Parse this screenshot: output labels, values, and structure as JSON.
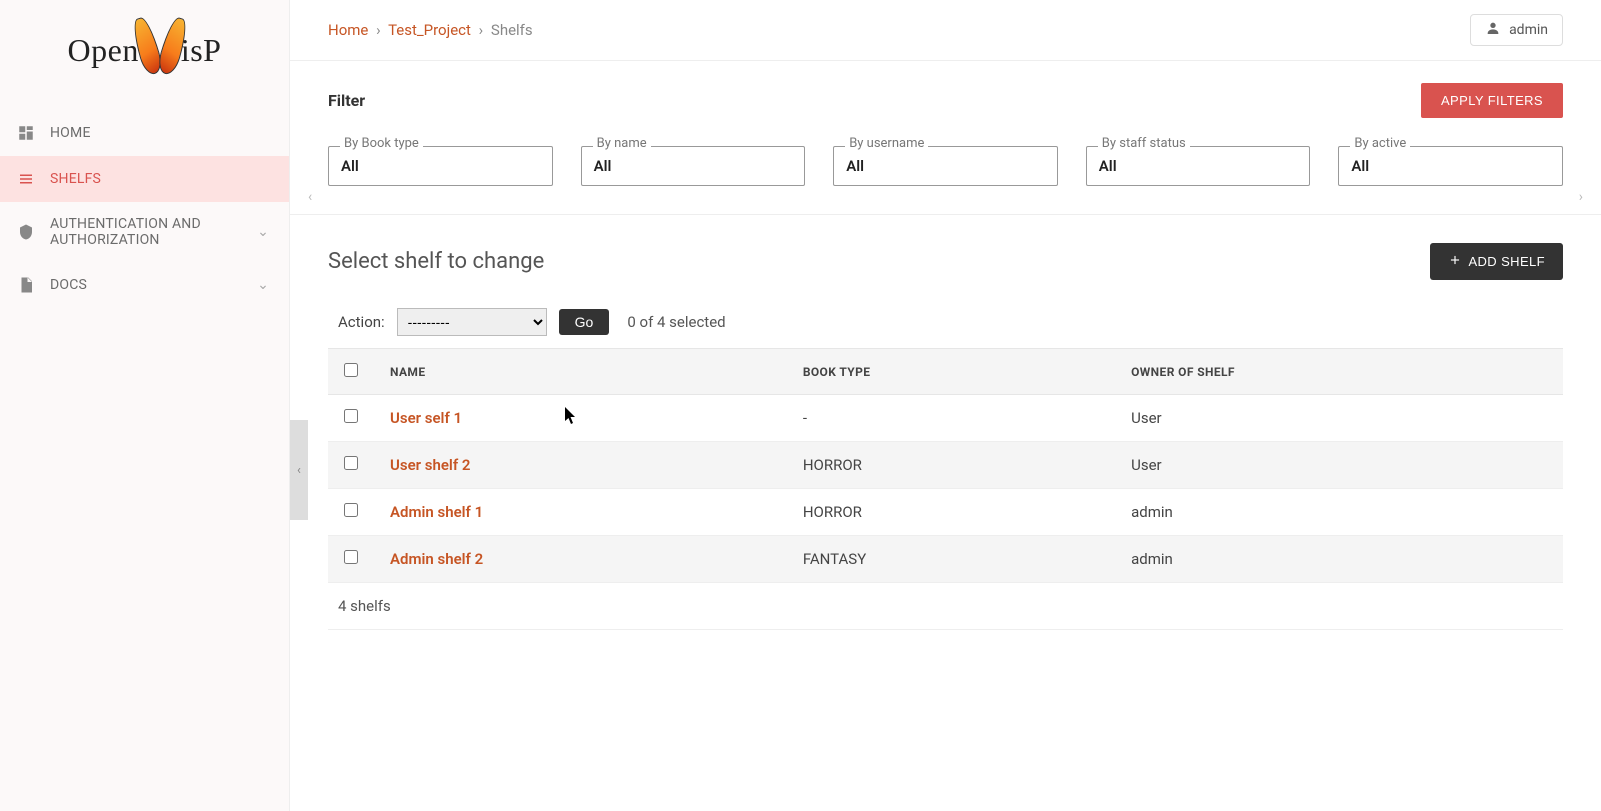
{
  "logo": "OpenWISP",
  "colors": {
    "accent": "#d9534f",
    "link": "#c65524"
  },
  "user": {
    "name": "admin"
  },
  "breadcrumbs": {
    "home": "Home",
    "project": "Test_Project",
    "current": "Shelfs"
  },
  "sidebar": {
    "items": [
      {
        "label": "HOME",
        "icon": "dashboard-icon",
        "active": false,
        "expandable": false
      },
      {
        "label": "SHELFS",
        "icon": "book-icon",
        "active": true,
        "expandable": false
      },
      {
        "label": "AUTHENTICATION AND AUTHORIZATION",
        "icon": "shield-icon",
        "active": false,
        "expandable": true
      },
      {
        "label": "DOCS",
        "icon": "doc-icon",
        "active": false,
        "expandable": true
      }
    ]
  },
  "filter": {
    "heading": "Filter",
    "apply_label": "APPLY FILTERS",
    "fields": [
      {
        "legend": "By Book type",
        "value": "All"
      },
      {
        "legend": "By name",
        "value": "All"
      },
      {
        "legend": "By username",
        "value": "All"
      },
      {
        "legend": "By staff status",
        "value": "All"
      },
      {
        "legend": "By active",
        "value": "All"
      }
    ]
  },
  "page_title": "Select shelf to change",
  "add_button": "ADD SHELF",
  "actions": {
    "label": "Action:",
    "placeholder": "---------",
    "go_label": "Go",
    "selected_text": "0 of 4 selected"
  },
  "table": {
    "columns": [
      "NAME",
      "BOOK TYPE",
      "OWNER OF SHELF"
    ],
    "rows": [
      {
        "name": "User self 1",
        "book_type": "-",
        "owner": "User"
      },
      {
        "name": "User shelf 2",
        "book_type": "HORROR",
        "owner": "User"
      },
      {
        "name": "Admin shelf 1",
        "book_type": "HORROR",
        "owner": "admin"
      },
      {
        "name": "Admin shelf 2",
        "book_type": "FANTASY",
        "owner": "admin"
      }
    ],
    "summary": "4 shelfs"
  }
}
